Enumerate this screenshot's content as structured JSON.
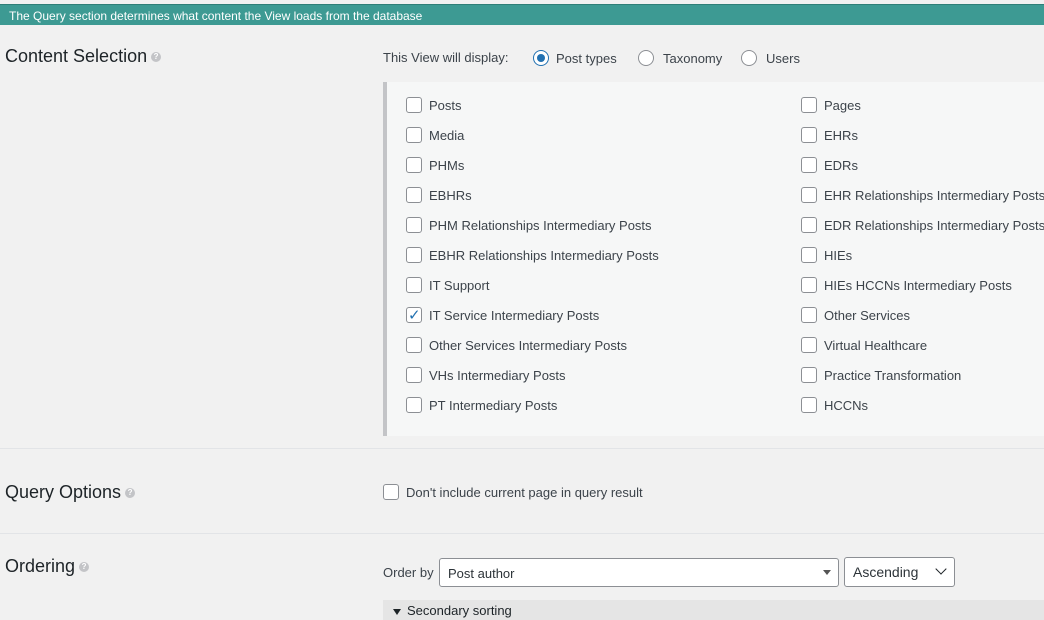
{
  "banner": "The Query section determines what content the View loads from the database",
  "content_selection": {
    "title": "Content Selection",
    "display_label": "This View will display:",
    "radio_options": [
      {
        "label": "Post types",
        "checked": true
      },
      {
        "label": "Taxonomy",
        "checked": false
      },
      {
        "label": "Users",
        "checked": false
      }
    ],
    "post_types_left": [
      {
        "label": "Posts",
        "checked": false
      },
      {
        "label": "Media",
        "checked": false
      },
      {
        "label": "PHMs",
        "checked": false
      },
      {
        "label": "EBHRs",
        "checked": false
      },
      {
        "label": "PHM Relationships Intermediary Posts",
        "checked": false
      },
      {
        "label": "EBHR Relationships Intermediary Posts",
        "checked": false
      },
      {
        "label": "IT Support",
        "checked": false
      },
      {
        "label": "IT Service Intermediary Posts",
        "checked": true
      },
      {
        "label": "Other Services Intermediary Posts",
        "checked": false
      },
      {
        "label": "VHs Intermediary Posts",
        "checked": false
      },
      {
        "label": "PT Intermediary Posts",
        "checked": false
      }
    ],
    "post_types_right": [
      {
        "label": "Pages",
        "checked": false
      },
      {
        "label": "EHRs",
        "checked": false
      },
      {
        "label": "EDRs",
        "checked": false
      },
      {
        "label": "EHR Relationships Intermediary Posts",
        "checked": false
      },
      {
        "label": "EDR Relationships Intermediary Posts",
        "checked": false
      },
      {
        "label": "HIEs",
        "checked": false
      },
      {
        "label": "HIEs HCCNs Intermediary Posts",
        "checked": false
      },
      {
        "label": "Other Services",
        "checked": false
      },
      {
        "label": "Virtual Healthcare",
        "checked": false
      },
      {
        "label": "Practice Transformation",
        "checked": false
      },
      {
        "label": "HCCNs",
        "checked": false
      }
    ]
  },
  "query_options": {
    "title": "Query Options",
    "exclude_current_label": "Don't include current page in query result",
    "exclude_current_checked": false
  },
  "ordering": {
    "title": "Ordering",
    "order_by_label": "Order by",
    "order_by_value": "Post author",
    "direction_value": "Ascending",
    "secondary_label": "Secondary sorting"
  },
  "colors": {
    "banner_bg": "#3d9a93",
    "accent": "#2271b1"
  }
}
